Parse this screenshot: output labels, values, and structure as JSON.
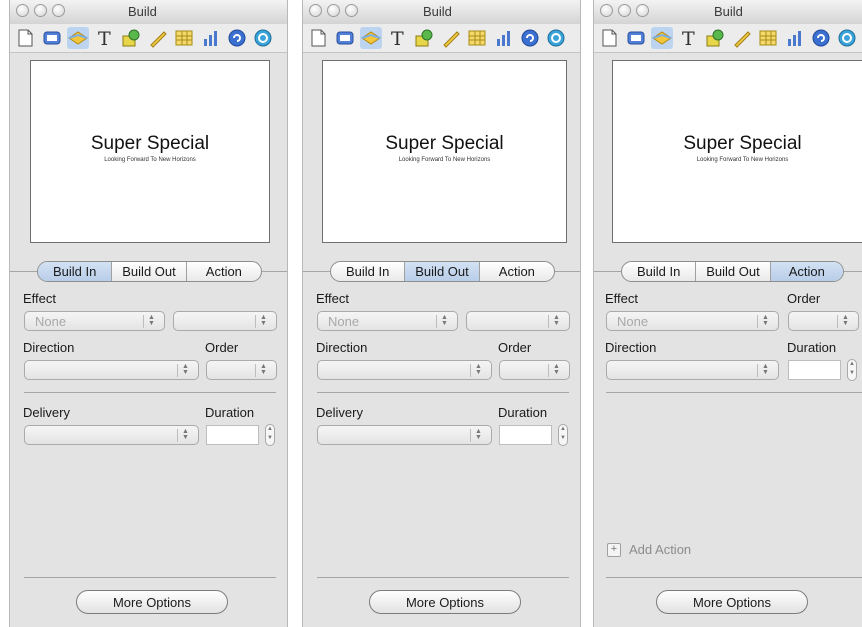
{
  "window_title": "Build",
  "toolbar_icons": [
    "document-icon",
    "slide-icon",
    "build-icon",
    "text-icon",
    "graphic-icon",
    "metrics-icon",
    "table-icon",
    "chart-icon",
    "hyperlink-icon",
    "quicktime-icon"
  ],
  "slide": {
    "title": "Super Special",
    "subtitle": "Looking Forward To New Horizons"
  },
  "tabs": [
    "Build In",
    "Build Out",
    "Action"
  ],
  "labels": {
    "effect": "Effect",
    "direction": "Direction",
    "order": "Order",
    "delivery": "Delivery",
    "duration": "Duration"
  },
  "effect_value": "None",
  "more_options": "More Options",
  "add_action": "Add Action",
  "colors": {
    "active_tab": "#c7d8ee",
    "toolbar_selected": "#bcd4ef"
  }
}
